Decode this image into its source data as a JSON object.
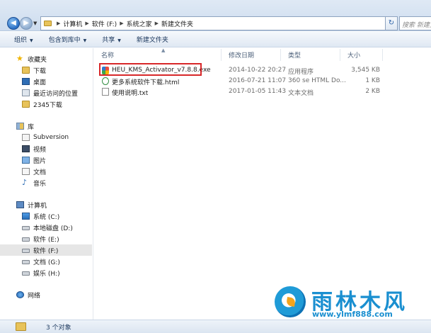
{
  "address": {
    "breadcrumbs": [
      "计算机",
      "软件 (F:)",
      "系统之家",
      "新建文件夹"
    ],
    "search_placeholder": "搜索 新建文件夹"
  },
  "toolbar": {
    "organize": "组织",
    "include_library": "包含到库中",
    "share": "共享",
    "new_folder": "新建文件夹"
  },
  "sidebar": {
    "favorites": "收藏夹",
    "downloads": "下载",
    "desktop": "桌面",
    "recent": "最近访问的位置",
    "dl2345": "2345下载",
    "libraries": "库",
    "subversion": "Subversion",
    "videos": "视频",
    "pictures": "图片",
    "documents": "文档",
    "music": "音乐",
    "computer": "计算机",
    "drive_c": "系统 (C:)",
    "drive_d": "本地磁盘 (D:)",
    "drive_e": "软件 (E:)",
    "drive_f": "软件 (F:)",
    "drive_g": "文档 (G:)",
    "drive_h": "娱乐 (H:)",
    "network": "网络"
  },
  "columns": {
    "name": "名称",
    "modified": "修改日期",
    "type": "类型",
    "size": "大小"
  },
  "files": [
    {
      "name": "HEU_KMS_Activator_v7.8.8.exe",
      "modified": "2014-10-22 20:27",
      "type": "应用程序",
      "size": "3,545 KB",
      "icon": "exe-icon"
    },
    {
      "name": "更多系统软件下载.html",
      "modified": "2016-07-21 11:07",
      "type": "360 se HTML Do...",
      "size": "1 KB",
      "icon": "html-icon"
    },
    {
      "name": "使用说明.txt",
      "modified": "2017-01-05 11:43",
      "type": "文本文档",
      "size": "2 KB",
      "icon": "txt-icon"
    }
  ],
  "status": {
    "count": "3 个对象"
  },
  "watermark": {
    "title": "雨林木风",
    "url": "www.ylmf888.com"
  },
  "colors": {
    "highlight": "#d8282a",
    "watermark": "#1a8fd0"
  }
}
